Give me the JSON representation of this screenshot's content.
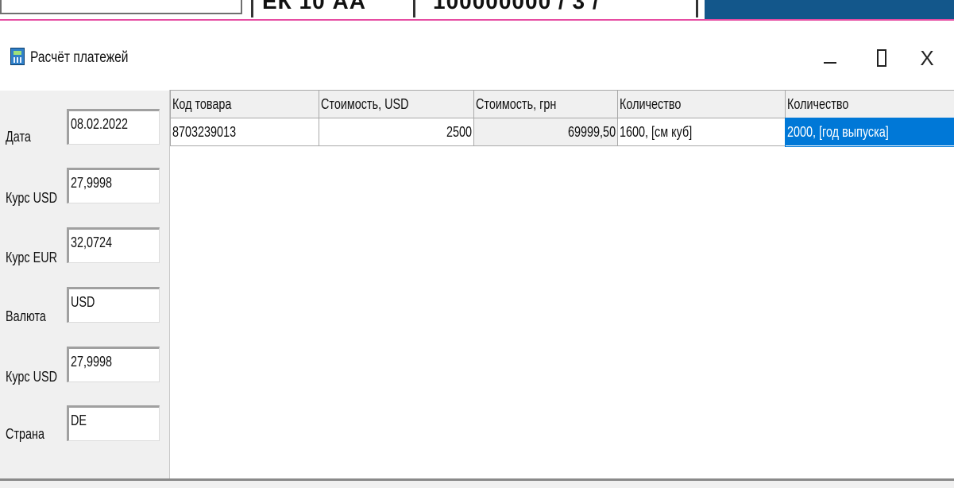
{
  "background_window": {
    "fragment_1": "ЕК 10 АА",
    "fragment_2": "100000000 / 3 /"
  },
  "window": {
    "title": "Расчёт платежей",
    "icon": "calculator-icon",
    "minimize_icon": "minimize-icon",
    "maximize_icon": "maximize-icon",
    "close_label": "X"
  },
  "form": {
    "fields": [
      {
        "label": "Дата",
        "value": "08.02.2022"
      },
      {
        "label": "Курс USD",
        "value": "27,9998"
      },
      {
        "label": "Курс EUR",
        "value": "32,0724"
      },
      {
        "label": "Валюта",
        "value": "USD"
      },
      {
        "label": "Курс USD",
        "value": "27,9998"
      },
      {
        "label": "Страна",
        "value": "DE"
      }
    ]
  },
  "grid": {
    "columns": [
      "Код товара",
      "Стоимость, USD",
      "Стоимость, грн",
      "Количество",
      "Количество"
    ],
    "rows": [
      [
        "8703239013",
        "2500",
        "69999,50",
        "1600, [см куб]",
        "2000, [год выпуска]"
      ]
    ]
  },
  "colors": {
    "selection": "#0078d7",
    "background_window_bar": "#13578b",
    "active_border": "#e64ca2"
  }
}
